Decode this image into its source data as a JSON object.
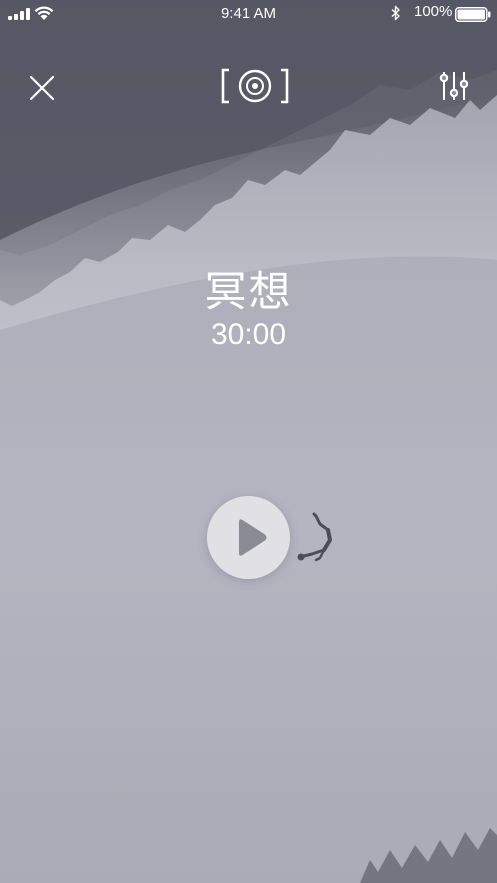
{
  "status_bar": {
    "time": "9:41 AM",
    "battery_percent": "100%",
    "signal_bars": 4,
    "battery_level": 1.0,
    "icons": [
      "signal-icon",
      "wifi-icon",
      "bluetooth-icon",
      "battery-icon"
    ]
  },
  "header": {
    "close_icon": "close-icon",
    "center_icon": "disc-icon",
    "settings_icon": "sliders-icon"
  },
  "session": {
    "title": "冥想",
    "duration": "30:00"
  },
  "player": {
    "play_icon": "play-icon"
  },
  "colors": {
    "text": "#ffffff",
    "play_button_bg": "#e4e4e8",
    "play_icon": "#8b8b95",
    "forest": "#4a4c58"
  }
}
